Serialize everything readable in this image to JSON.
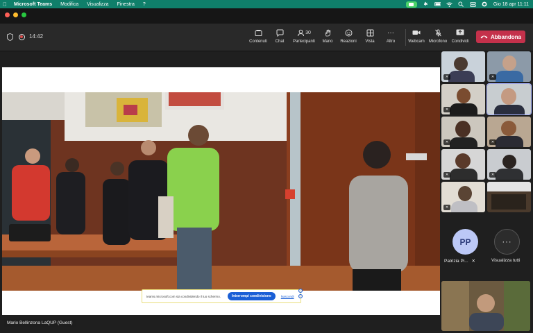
{
  "menubar": {
    "app_name": "Microsoft Teams",
    "items": [
      "Modifica",
      "Visualizza",
      "Finestra",
      "?"
    ],
    "datetime": "Gio 18 apr  11:11"
  },
  "toolbar": {
    "timer": "14:42",
    "buttons": {
      "contenuti": "Contenuti",
      "chat": "Chat",
      "partecipanti": "Partecipanti",
      "partecipanti_count": "30",
      "mano": "Mano",
      "reazioni": "Reazioni",
      "vista": "Vista",
      "altro": "Altro",
      "webcam": "Webcam",
      "microfono": "Microfono",
      "condividi": "Condividi"
    },
    "leave_label": "Abbandona"
  },
  "share_bar": {
    "message": "teams.microsoft.com sta condividendo il tuo schermo.",
    "stop_label": "Interrompi condivisione",
    "hide_label": "Nascondi"
  },
  "speaker_name": "Mario Bellinzona LaQUP (Guest)",
  "participants": {
    "avatar_initials": "PP",
    "avatar_name": "Patrizia Pi...",
    "view_all": "Visualizza tutti"
  },
  "colors": {
    "menubar": "#0f7f6a",
    "leave": "#c4314b",
    "accent": "#1a5fd6"
  }
}
